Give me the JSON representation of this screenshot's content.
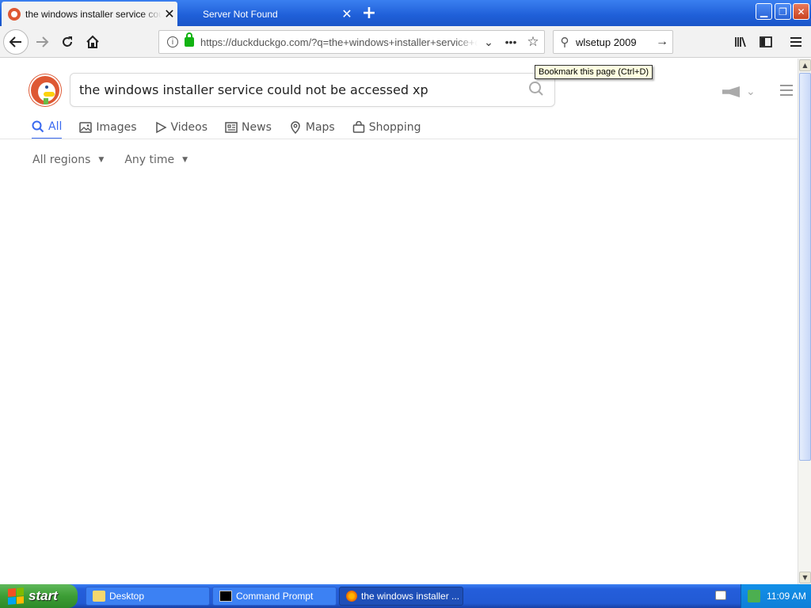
{
  "browser": {
    "tabs": [
      {
        "title": "the windows installer service could not be accessed xp",
        "active": true
      },
      {
        "title": "Server Not Found",
        "active": false
      }
    ],
    "new_tab_label": "+",
    "url": "https://duckduckgo.com/?q=the+windows+installer+service+could+not+be+accessed+xp",
    "search_box_value": "wlsetup 2009",
    "tooltip": "Bookmark this page (Ctrl+D)"
  },
  "page": {
    "search_query": "the windows installer service could not be accessed xp",
    "tabs": [
      {
        "label": "All",
        "icon": "search-icon",
        "active": true
      },
      {
        "label": "Images",
        "icon": "image-icon",
        "active": false
      },
      {
        "label": "Videos",
        "icon": "play-icon",
        "active": false
      },
      {
        "label": "News",
        "icon": "newspaper-icon",
        "active": false
      },
      {
        "label": "Maps",
        "icon": "map-pin-icon",
        "active": false
      },
      {
        "label": "Shopping",
        "icon": "shopping-bag-icon",
        "active": false
      }
    ],
    "filters": {
      "region": "All regions",
      "time": "Any time"
    }
  },
  "taskbar": {
    "start_label": "start",
    "items": [
      {
        "label": "Desktop",
        "active": false
      },
      {
        "label": "Command Prompt",
        "active": false
      },
      {
        "label": "the windows installer ...",
        "active": true
      }
    ],
    "clock": "11:09 AM"
  },
  "colors": {
    "ddg_orange": "#de5833",
    "ddg_active_blue": "#3969ef",
    "xp_taskbar_blue": "#245edb",
    "xp_start_green": "#3c9d35"
  }
}
